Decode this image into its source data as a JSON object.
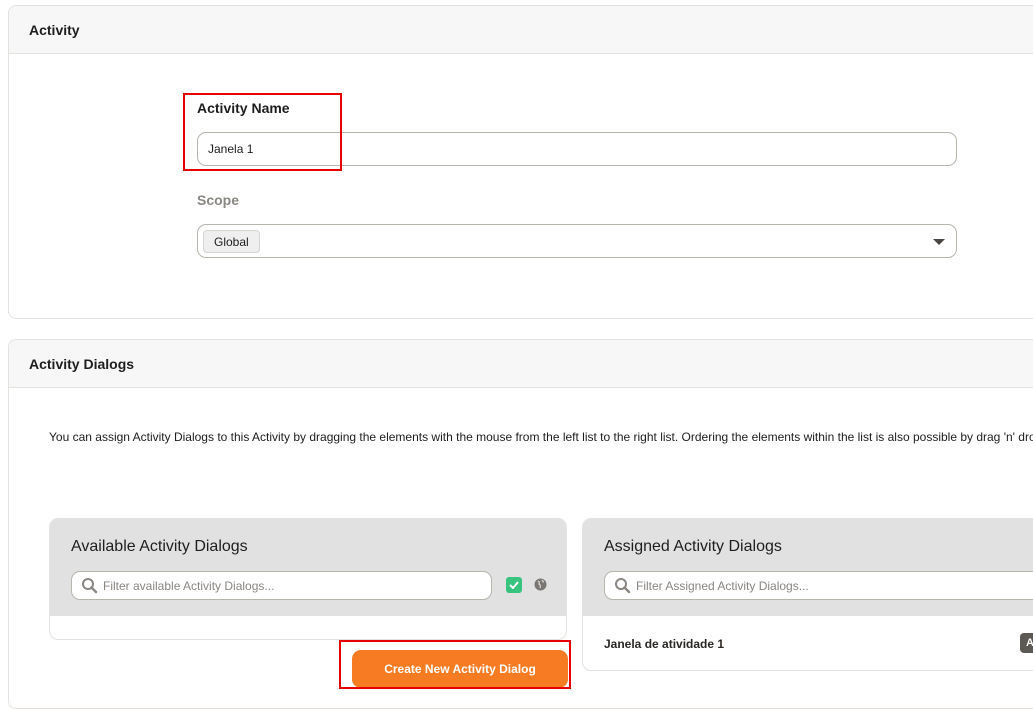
{
  "activity_widget": {
    "title": "Activity",
    "name_label": "Activity Name",
    "name_value": "Janela 1",
    "scope_label": "Scope",
    "scope_selected": "Global"
  },
  "dialogs_widget": {
    "title": "Activity Dialogs",
    "description": "You can assign Activity Dialogs to this Activity by dragging the elements with the mouse from the left list to the right list. Ordering the elements within the list is also possible by drag 'n' drop.",
    "available": {
      "title": "Available Activity Dialogs",
      "filter_placeholder": "Filter available Activity Dialogs...",
      "items": []
    },
    "assigned": {
      "title": "Assigned Activity Dialogs",
      "filter_placeholder": "Filter Assigned Activity Dialogs...",
      "items": [
        {
          "label": "Janela de atividade 1",
          "badge": "A"
        }
      ]
    },
    "create_button_label": "Create New Activity Dialog"
  },
  "colors": {
    "accent": "#f77b23",
    "checkbox": "#38c47f",
    "highlight": "#e60000"
  }
}
